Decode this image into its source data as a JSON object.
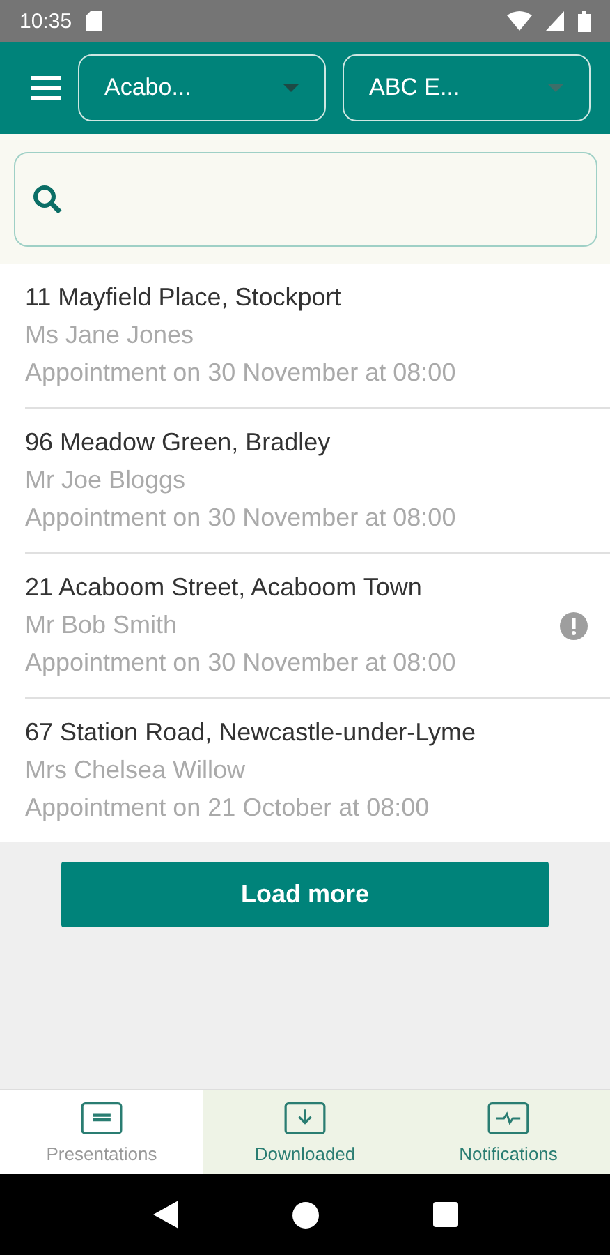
{
  "status_bar": {
    "time": "10:35"
  },
  "app_bar": {
    "dropdowns": [
      {
        "value": "Acabo..."
      },
      {
        "value": "ABC E..."
      }
    ]
  },
  "appointments": [
    {
      "address": "11 Mayfield Place, Stockport",
      "name": "Ms Jane Jones",
      "appointment": "Appointment on 30 November at 08:00",
      "warning": false
    },
    {
      "address": "96 Meadow Green, Bradley",
      "name": "Mr Joe Bloggs",
      "appointment": "Appointment on 30 November at 08:00",
      "warning": false
    },
    {
      "address": "21 Acaboom Street, Acaboom Town",
      "name": "Mr Bob Smith",
      "appointment": "Appointment on 30 November at 08:00",
      "warning": true
    },
    {
      "address": "67 Station Road, Newcastle-under-Lyme",
      "name": "Mrs Chelsea Willow",
      "appointment": "Appointment on 21 October at 08:00",
      "warning": false
    }
  ],
  "load_more": "Load more",
  "bottom_nav": [
    {
      "label": "Presentations",
      "kind": "presentations",
      "selected": true
    },
    {
      "label": "Downloaded",
      "kind": "download",
      "selected": false
    },
    {
      "label": "Notifications",
      "kind": "pulse",
      "selected": false
    }
  ]
}
